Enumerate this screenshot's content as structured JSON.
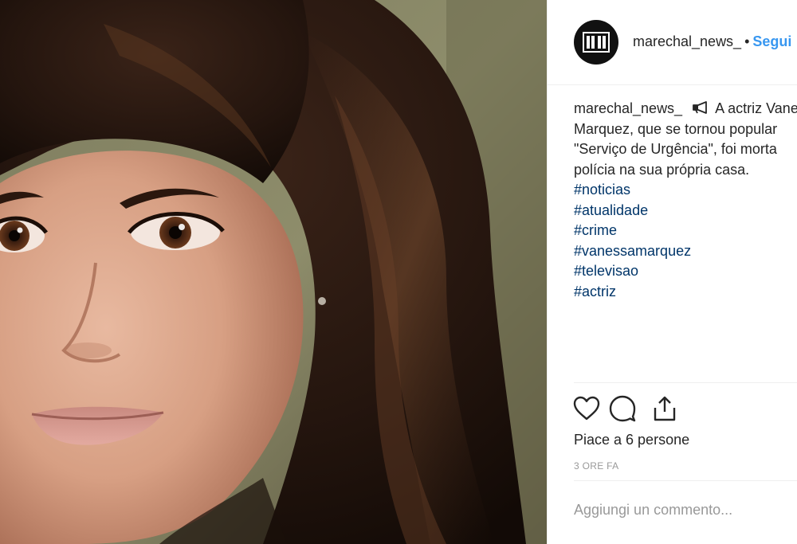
{
  "post": {
    "author": {
      "username": "marechal_news_",
      "separator": "•",
      "follow_label": "Segui"
    },
    "caption": {
      "username": "marechal_news_",
      "icon": "megaphone-icon",
      "lines": [
        "A actriz Vanessa",
        "Marquez, que se tornou popular",
        "\"Serviço de Urgência\", foi morta",
        "polícia na sua própria casa."
      ],
      "hashtags": [
        "#noticias",
        "#atualidade",
        "#crime",
        "#vanessamarquez",
        "#televisao",
        "#actriz"
      ]
    },
    "actions": {
      "like_icon": "heart-icon",
      "comment_icon": "comment-icon",
      "share_icon": "share-icon"
    },
    "likes_text": "Piace a 6 persone",
    "timestamp": "3 ORE FA",
    "comment_placeholder": "Aggiungi un commento..."
  },
  "colors": {
    "link": "#3897f0",
    "hashtag": "#003569",
    "text": "#262626",
    "muted": "#999999"
  }
}
